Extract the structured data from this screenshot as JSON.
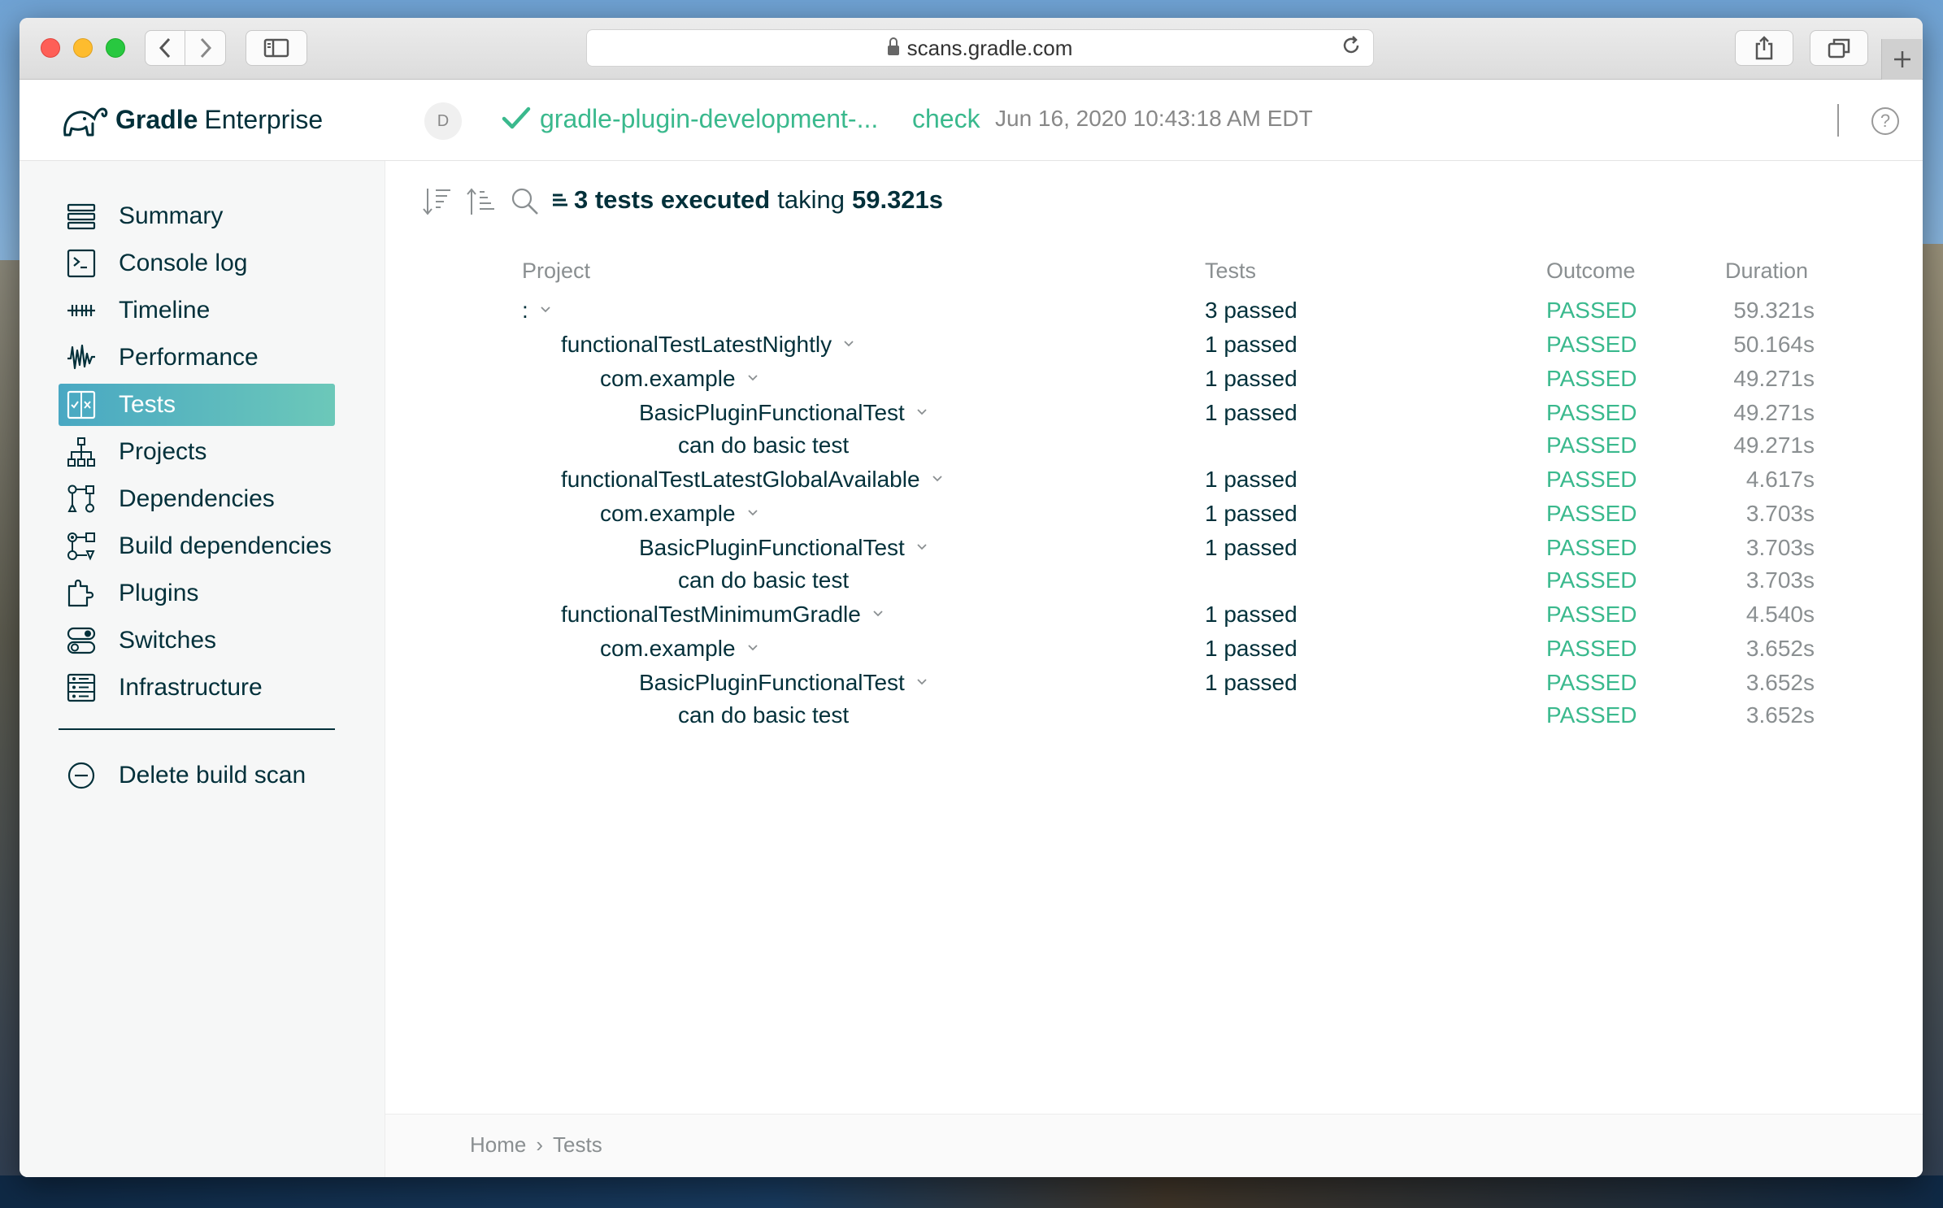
{
  "browser": {
    "url": "scans.gradle.com"
  },
  "header": {
    "logo_brand": "Gradle",
    "logo_product": "Enterprise",
    "avatar_initial": "D",
    "build_name": "gradle-plugin-development-...",
    "build_task": "check",
    "build_date": "Jun 16, 2020 10:43:18 AM EDT",
    "help_symbol": "?"
  },
  "sidebar": {
    "items": [
      {
        "label": "Summary",
        "icon": "summary-icon"
      },
      {
        "label": "Console log",
        "icon": "console-icon"
      },
      {
        "label": "Timeline",
        "icon": "timeline-icon"
      },
      {
        "label": "Performance",
        "icon": "performance-icon"
      },
      {
        "label": "Tests",
        "icon": "tests-icon",
        "active": true
      },
      {
        "label": "Projects",
        "icon": "projects-icon"
      },
      {
        "label": "Dependencies",
        "icon": "dependencies-icon"
      },
      {
        "label": "Build dependencies",
        "icon": "build-dependencies-icon"
      },
      {
        "label": "Plugins",
        "icon": "plugins-icon"
      },
      {
        "label": "Switches",
        "icon": "switches-icon"
      },
      {
        "label": "Infrastructure",
        "icon": "infrastructure-icon"
      }
    ],
    "delete_label": "Delete build scan"
  },
  "main": {
    "summary": {
      "count_text": "3 tests executed",
      "taking": "taking",
      "duration": "59.321s"
    },
    "columns": {
      "project": "Project",
      "tests": "Tests",
      "outcome": "Outcome",
      "duration": "Duration"
    },
    "rows": [
      {
        "name": ":",
        "level": 0,
        "expandable": true,
        "tests": "3 passed",
        "outcome": "PASSED",
        "duration": "59.321s"
      },
      {
        "name": "functionalTestLatestNightly",
        "level": 1,
        "expandable": true,
        "tests": "1 passed",
        "outcome": "PASSED",
        "duration": "50.164s"
      },
      {
        "name": "com.example",
        "level": 2,
        "expandable": true,
        "tests": "1 passed",
        "outcome": "PASSED",
        "duration": "49.271s"
      },
      {
        "name": "BasicPluginFunctionalTest",
        "level": 3,
        "expandable": true,
        "tests": "1 passed",
        "outcome": "PASSED",
        "duration": "49.271s"
      },
      {
        "name": "can do basic test",
        "level": 4,
        "expandable": false,
        "tests": "",
        "outcome": "PASSED",
        "duration": "49.271s"
      },
      {
        "name": "functionalTestLatestGlobalAvailable",
        "level": 1,
        "expandable": true,
        "tests": "1 passed",
        "outcome": "PASSED",
        "duration": "4.617s"
      },
      {
        "name": "com.example",
        "level": 2,
        "expandable": true,
        "tests": "1 passed",
        "outcome": "PASSED",
        "duration": "3.703s"
      },
      {
        "name": "BasicPluginFunctionalTest",
        "level": 3,
        "expandable": true,
        "tests": "1 passed",
        "outcome": "PASSED",
        "duration": "3.703s"
      },
      {
        "name": "can do basic test",
        "level": 4,
        "expandable": false,
        "tests": "",
        "outcome": "PASSED",
        "duration": "3.703s"
      },
      {
        "name": "functionalTestMinimumGradle",
        "level": 1,
        "expandable": true,
        "tests": "1 passed",
        "outcome": "PASSED",
        "duration": "4.540s"
      },
      {
        "name": "com.example",
        "level": 2,
        "expandable": true,
        "tests": "1 passed",
        "outcome": "PASSED",
        "duration": "3.652s"
      },
      {
        "name": "BasicPluginFunctionalTest",
        "level": 3,
        "expandable": true,
        "tests": "1 passed",
        "outcome": "PASSED",
        "duration": "3.652s"
      },
      {
        "name": "can do basic test",
        "level": 4,
        "expandable": false,
        "tests": "",
        "outcome": "PASSED",
        "duration": "3.652s"
      }
    ]
  },
  "breadcrumb": {
    "home": "Home",
    "separator": "›",
    "current": "Tests"
  },
  "colors": {
    "accent_green": "#3ab98d",
    "text_dark": "#02303a",
    "muted": "#8a8f91",
    "active_gradient_start": "#49a8c3",
    "active_gradient_end": "#6cc8b9"
  }
}
